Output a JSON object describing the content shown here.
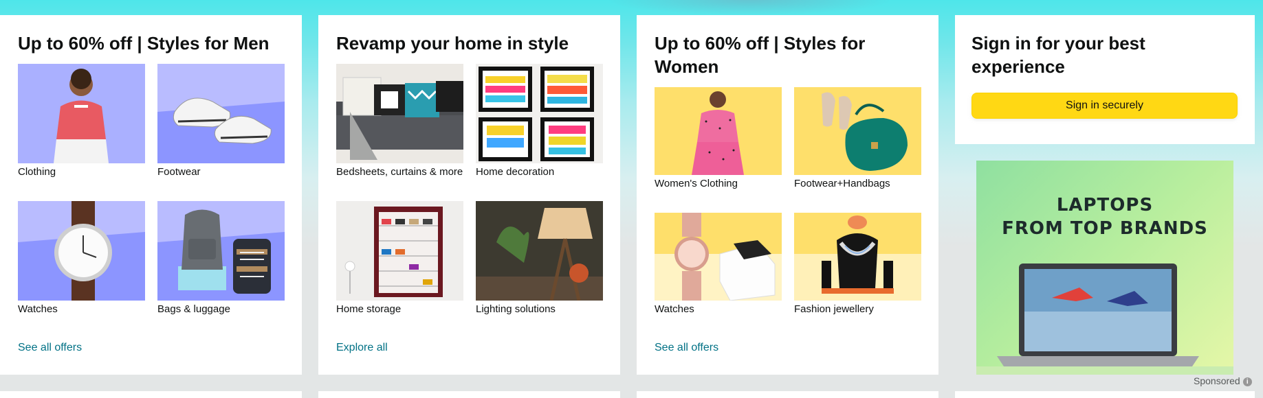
{
  "cards": [
    {
      "title": "Up to 60% off | Styles for Men",
      "tiles": [
        {
          "label": "Clothing"
        },
        {
          "label": "Footwear"
        },
        {
          "label": "Watches"
        },
        {
          "label": "Bags & luggage"
        }
      ],
      "link": "See all offers"
    },
    {
      "title": "Revamp your home in style",
      "tiles": [
        {
          "label": "Bedsheets, curtains & more"
        },
        {
          "label": "Home decoration"
        },
        {
          "label": "Home storage"
        },
        {
          "label": "Lighting solutions"
        }
      ],
      "link": "Explore all"
    },
    {
      "title": "Up to 60% off | Styles for Women",
      "tiles": [
        {
          "label": "Women's Clothing"
        },
        {
          "label": "Footwear+Handbags"
        },
        {
          "label": "Watches"
        },
        {
          "label": "Fashion jewellery"
        }
      ],
      "link": "See all offers"
    }
  ],
  "signin": {
    "title": "Sign in for your best experience",
    "button": "Sign in securely"
  },
  "ad": {
    "line1": "LAPTOPS",
    "line2": "FROM TOP BRANDS",
    "sponsored": "Sponsored",
    "info_icon": "i"
  },
  "colors": {
    "link": "#007185",
    "button": "#ffd814",
    "men_tile_bg": "#aab0ff",
    "women_tile_bg": "#ffe066"
  }
}
